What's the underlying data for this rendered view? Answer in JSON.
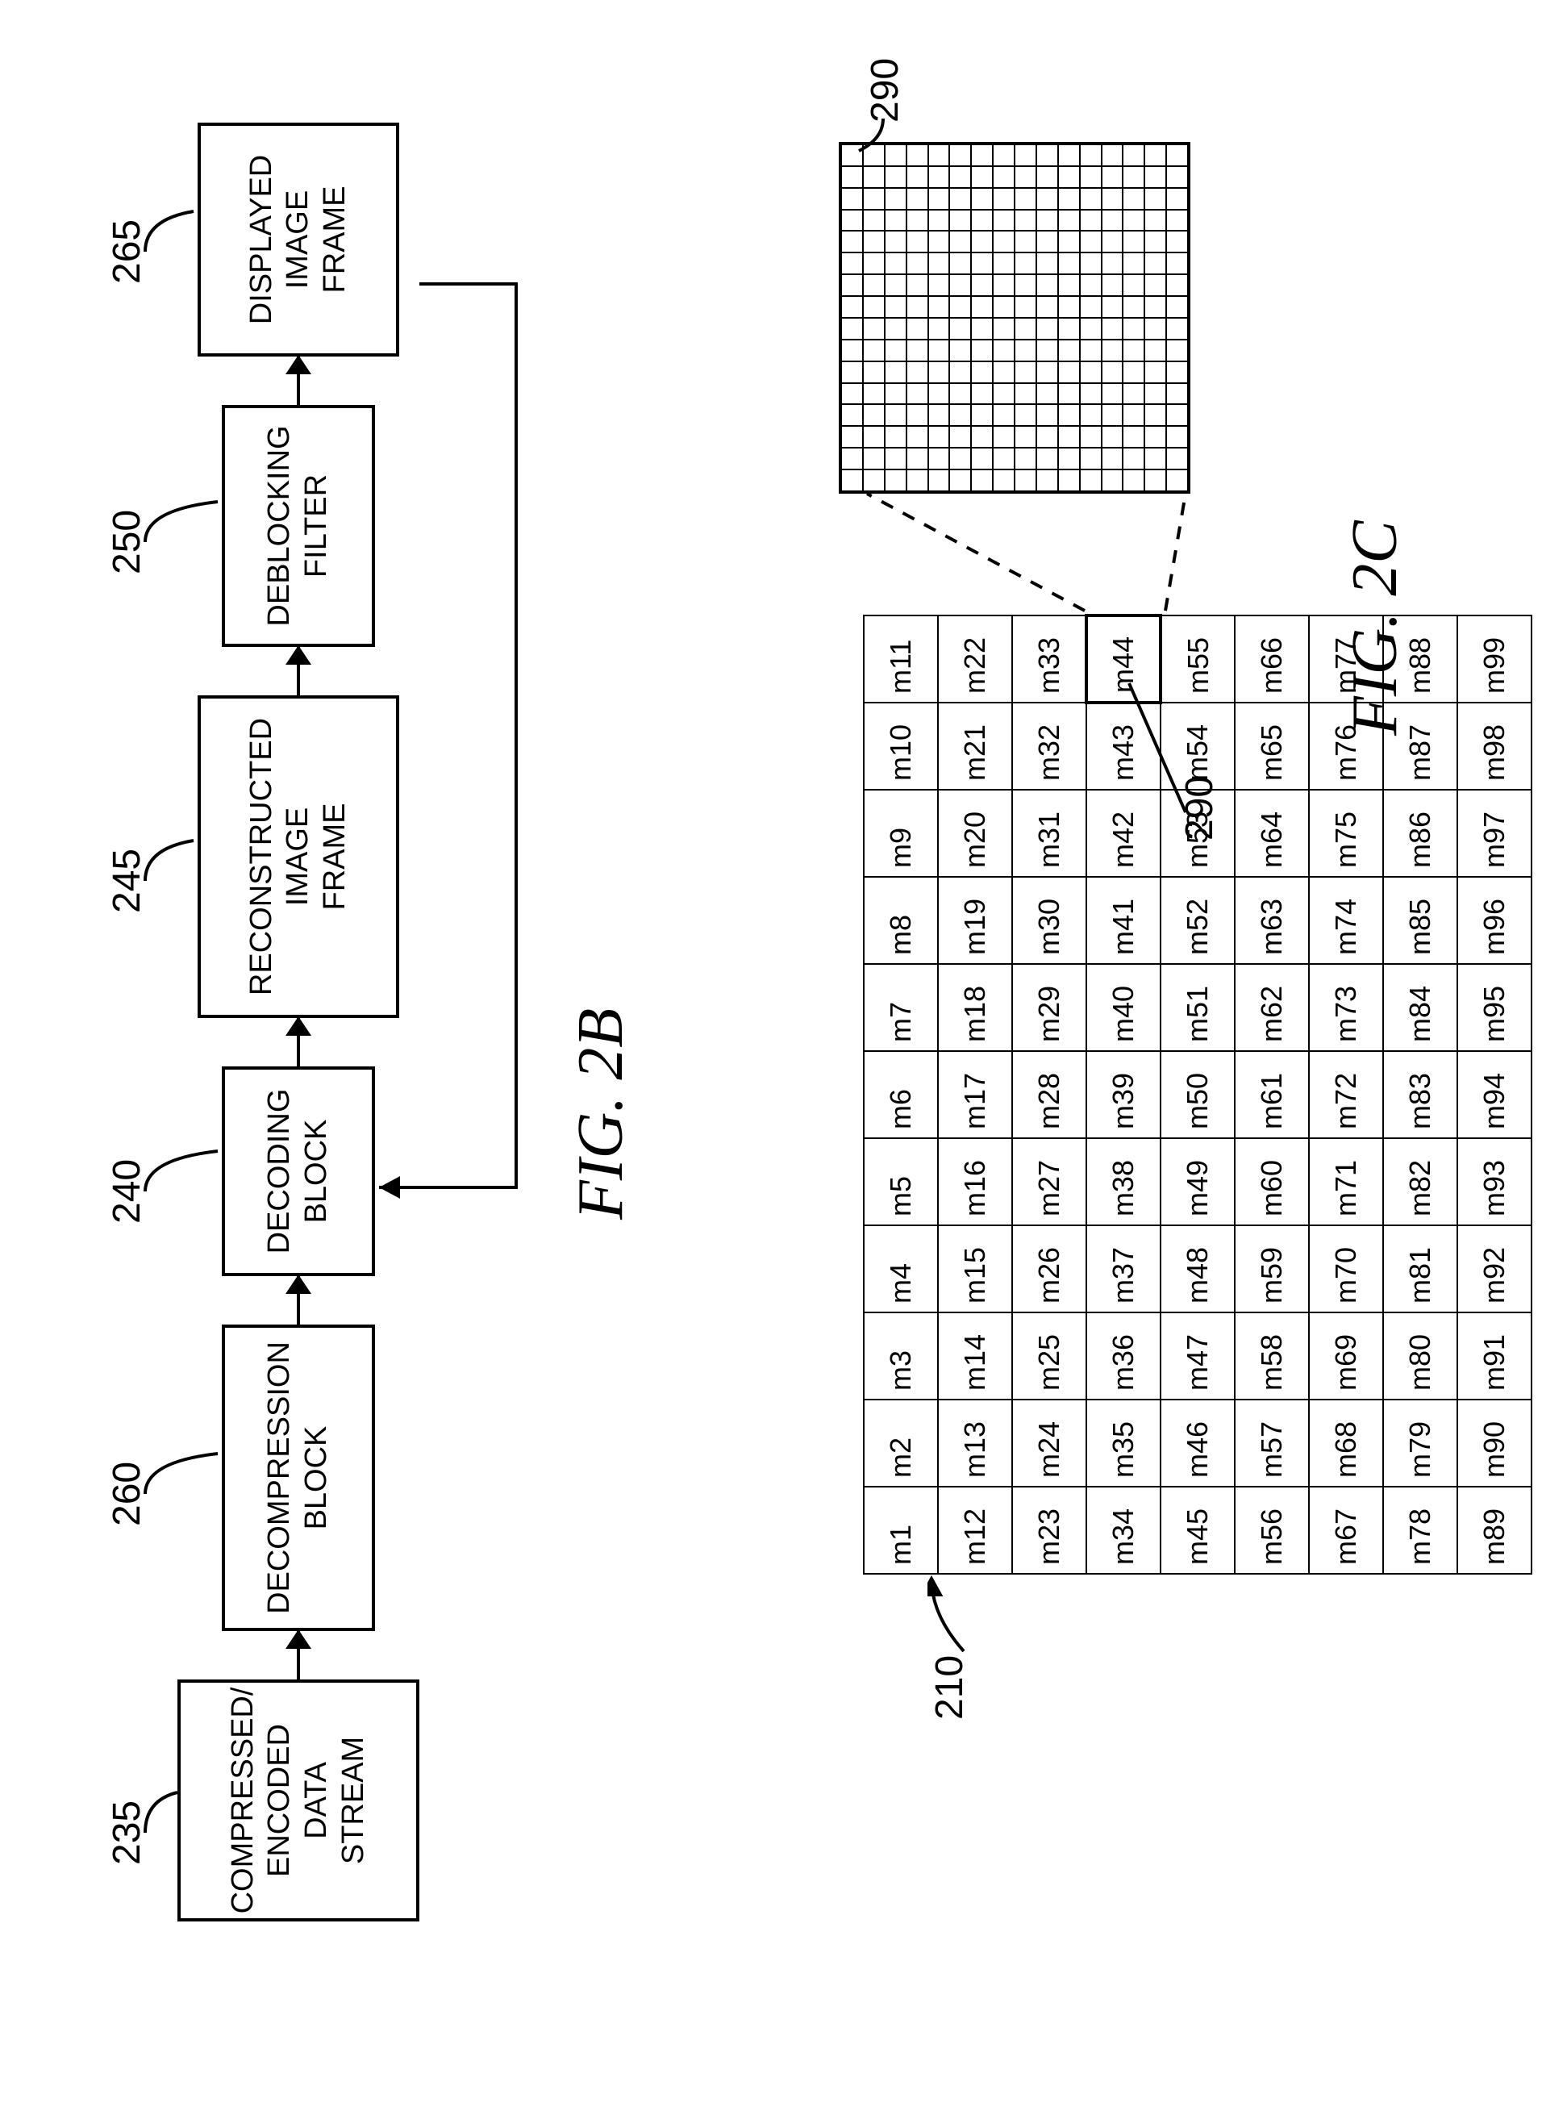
{
  "fig2b": {
    "caption": "FIG. 2B",
    "blocks": {
      "b235": {
        "ref": "235",
        "label": "COMPRESSED/\nENCODED\nDATA\nSTREAM"
      },
      "b260": {
        "ref": "260",
        "label": "DECOMPRESSION\nBLOCK"
      },
      "b240": {
        "ref": "240",
        "label": "DECODING\nBLOCK"
      },
      "b245": {
        "ref": "245",
        "label": "RECONSTRUCTED\nIMAGE\nFRAME"
      },
      "b250": {
        "ref": "250",
        "label": "DEBLOCKING\nFILTER"
      },
      "b265": {
        "ref": "265",
        "label": "DISPLAYED\nIMAGE\nFRAME"
      }
    }
  },
  "fig2c": {
    "caption": "FIG. 2C",
    "ref_frame": "210",
    "ref_macroblock": "290",
    "grid_cols": 11,
    "grid_rows": 9,
    "cells": [
      [
        "m1",
        "m2",
        "m3",
        "m4",
        "m5",
        "m6",
        "m7",
        "m8",
        "m9",
        "m10",
        "m11"
      ],
      [
        "m12",
        "m13",
        "m14",
        "m15",
        "m16",
        "m17",
        "m18",
        "m19",
        "m20",
        "m21",
        "m22"
      ],
      [
        "m23",
        "m24",
        "m25",
        "m26",
        "m27",
        "m28",
        "m29",
        "m30",
        "m31",
        "m32",
        "m33"
      ],
      [
        "m34",
        "m35",
        "m36",
        "m37",
        "m38",
        "m39",
        "m40",
        "m41",
        "m42",
        "m43",
        "m44"
      ],
      [
        "m45",
        "m46",
        "m47",
        "m48",
        "m49",
        "m50",
        "m51",
        "m52",
        "m53",
        "m54",
        "m55"
      ],
      [
        "m56",
        "m57",
        "m58",
        "m59",
        "m60",
        "m61",
        "m62",
        "m63",
        "m64",
        "m65",
        "m66"
      ],
      [
        "m67",
        "m68",
        "m69",
        "m70",
        "m71",
        "m72",
        "m73",
        "m74",
        "m75",
        "m76",
        "m77"
      ],
      [
        "m78",
        "m79",
        "m80",
        "m81",
        "m82",
        "m83",
        "m84",
        "m85",
        "m86",
        "m87",
        "m88"
      ],
      [
        "m89",
        "m90",
        "m91",
        "m92",
        "m93",
        "m94",
        "m95",
        "m96",
        "m97",
        "m98",
        "m99"
      ]
    ],
    "highlight_cell": [
      3,
      10
    ],
    "zoom_grid_size": 16
  }
}
